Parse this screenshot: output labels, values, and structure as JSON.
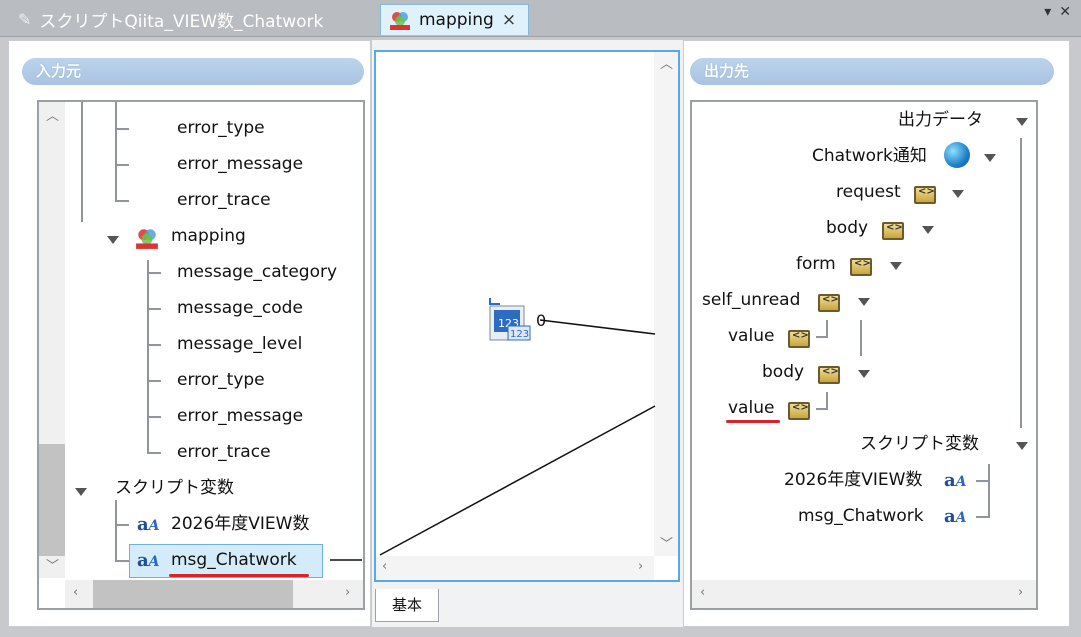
{
  "tabs": [
    {
      "label": "スクリプトQiita_VIEW数_Chatwork",
      "active": false
    },
    {
      "label": "mapping",
      "active": true
    }
  ],
  "tab_close": "×",
  "window_controls": {
    "menu": "▾",
    "close": "✕"
  },
  "left_panel": {
    "header": "入力元",
    "nodes": [
      {
        "label": "error_type"
      },
      {
        "label": "error_message"
      },
      {
        "label": "error_trace"
      },
      {
        "label": "mapping"
      },
      {
        "label": "message_category"
      },
      {
        "label": "message_code"
      },
      {
        "label": "message_level"
      },
      {
        "label": "error_type"
      },
      {
        "label": "error_message"
      },
      {
        "label": "error_trace"
      },
      {
        "label": "スクリプト変数"
      },
      {
        "label": "2026年度VIEW数"
      },
      {
        "label": "msg_Chatwork"
      }
    ]
  },
  "middle_panel": {
    "converter_value": "0",
    "bottom_tab": "基本"
  },
  "right_panel": {
    "header": "出力先",
    "nodes": [
      {
        "label": "出力データ"
      },
      {
        "label": "Chatwork通知"
      },
      {
        "label": "request"
      },
      {
        "label": "body"
      },
      {
        "label": "form"
      },
      {
        "label": "self_unread"
      },
      {
        "label": "value"
      },
      {
        "label": "body"
      },
      {
        "label": "value"
      },
      {
        "label": "スクリプト変数"
      },
      {
        "label": "2026年度VIEW数"
      },
      {
        "label": "msg_Chatwork"
      }
    ]
  },
  "colors": {
    "accent": "#5aa9e6",
    "header": "#a8c3e1",
    "underline": "#d9232a"
  }
}
